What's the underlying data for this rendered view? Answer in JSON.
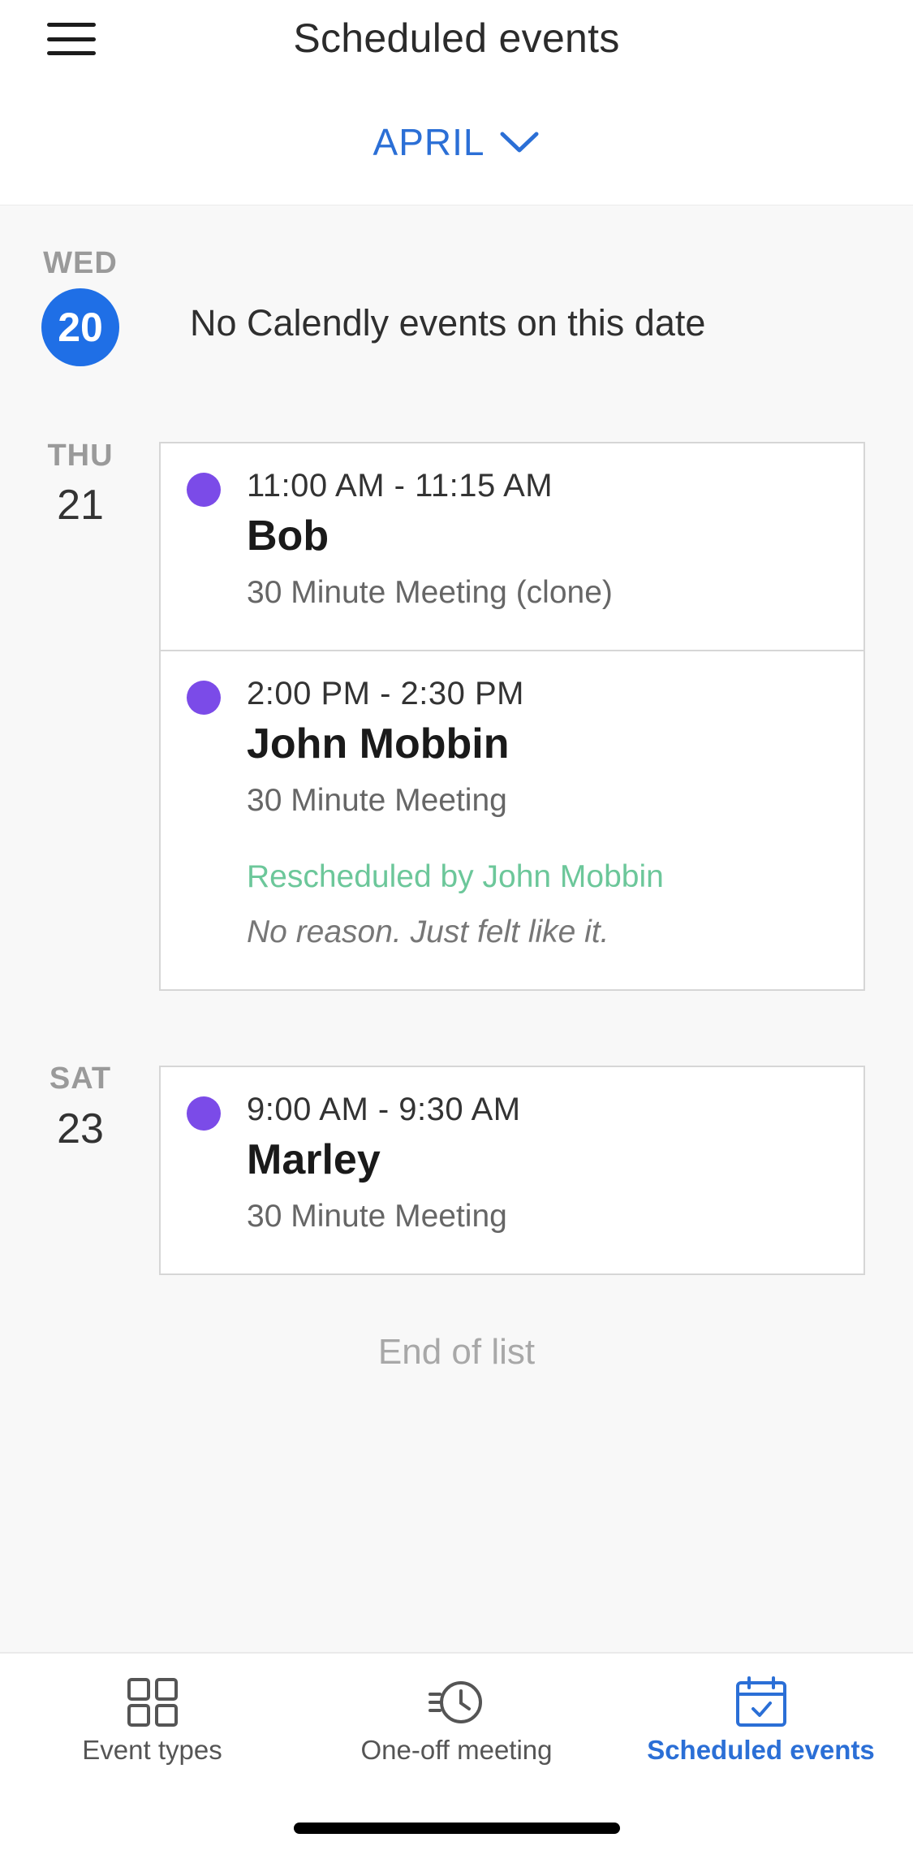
{
  "header": {
    "title": "Scheduled events",
    "month": "APRIL"
  },
  "days": [
    {
      "weekday": "WED",
      "date": "20",
      "today": true,
      "empty_text": "No Calendly events on this date"
    },
    {
      "weekday": "THU",
      "date": "21"
    },
    {
      "weekday": "SAT",
      "date": "23"
    }
  ],
  "events": [
    {
      "time": "11:00 AM - 11:15 AM",
      "name": "Bob",
      "type": "30 Minute Meeting (clone)",
      "color": "#7b4be8"
    },
    {
      "time": "2:00 PM - 2:30 PM",
      "name": "John Mobbin",
      "type": "30 Minute Meeting",
      "rescheduled": "Rescheduled by John Mobbin",
      "reason": "No reason. Just felt like it.",
      "color": "#7b4be8"
    },
    {
      "time": "9:00 AM - 9:30 AM",
      "name": "Marley",
      "type": "30 Minute Meeting",
      "color": "#7b4be8"
    }
  ],
  "end_text": "End of list",
  "tabs": [
    {
      "label": "Event types",
      "icon": "grid-icon",
      "active": false
    },
    {
      "label": "One-off meeting",
      "icon": "clock-icon",
      "active": false
    },
    {
      "label": "Scheduled events",
      "icon": "calendar-check-icon",
      "active": true
    }
  ],
  "colors": {
    "accent": "#2b6fd6",
    "today": "#1f6fe6",
    "event_dot": "#7b4be8",
    "rescheduled": "#6cc79a"
  }
}
